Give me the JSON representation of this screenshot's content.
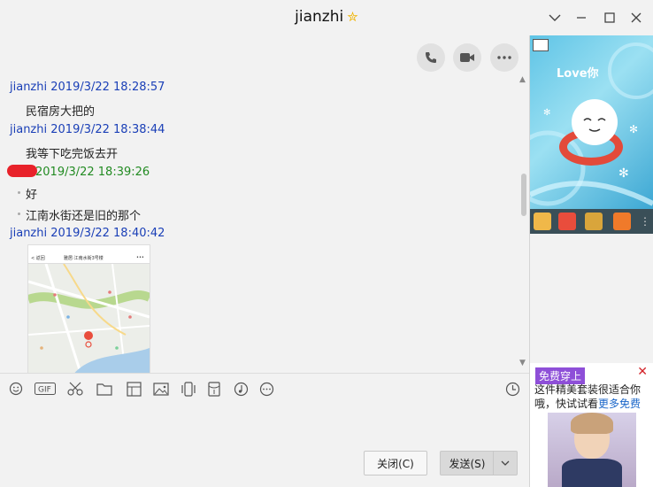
{
  "window": {
    "title": "jianzhi"
  },
  "messages": [
    {
      "sender": "jianzhi",
      "time": "2019/3/22 18:28:57",
      "lines": [
        "民宿房大把的"
      ]
    },
    {
      "sender": "jianzhi",
      "time": "2019/3/22 18:38:44",
      "lines": [
        "我等下吃完饭去开"
      ]
    },
    {
      "sender": "",
      "time": "2019/3/22 18:39:26",
      "lines": [
        "好",
        "江南水街还是旧的那个"
      ]
    },
    {
      "sender": "jianzhi",
      "time": "2019/3/22 18:40:42",
      "lines": []
    }
  ],
  "map_image": {
    "back": "< 返回",
    "title": "雅居·江南水街3号楼",
    "more": "•••"
  },
  "buttons": {
    "close": "关闭(C)",
    "send": "发送(S)"
  },
  "ad": {
    "tag": "免费穿上",
    "text": "这件精美套装很适合你哦，快试试看",
    "more": "更多免费",
    "close": "✕"
  },
  "right_panel": {
    "caption": "Love你"
  }
}
